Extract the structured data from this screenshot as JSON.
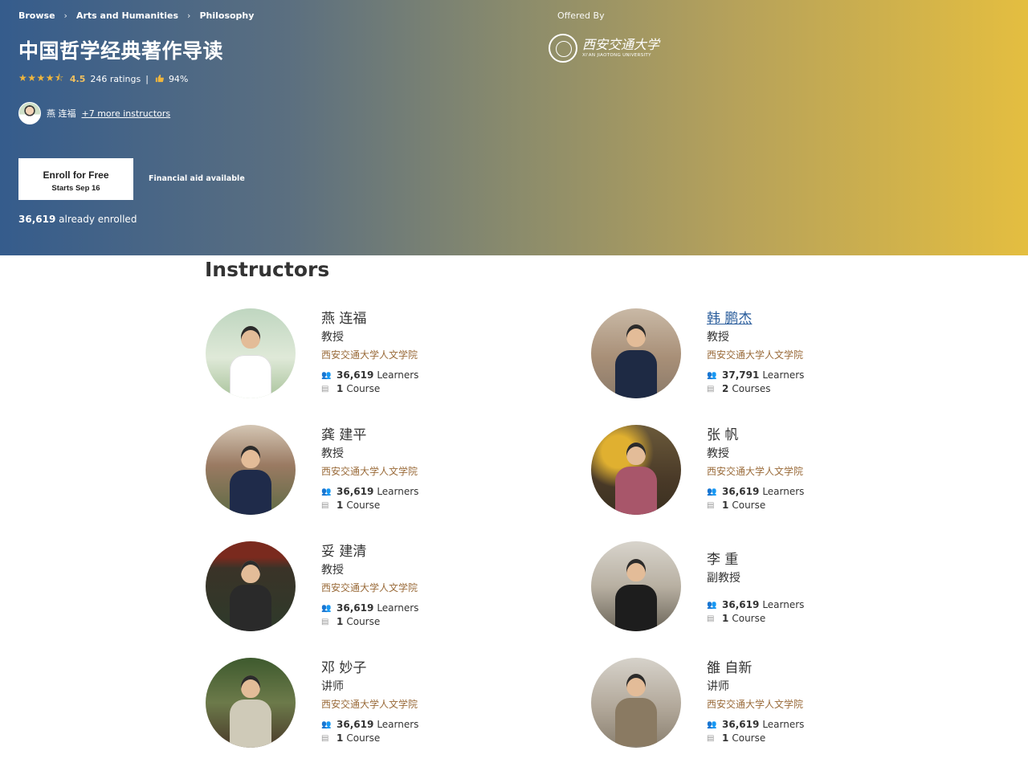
{
  "breadcrumb": {
    "items": [
      "Browse",
      "Arts and Humanities",
      "Philosophy"
    ]
  },
  "course": {
    "title": "中国哲学经典著作导读",
    "rating": "4.5",
    "ratings_count": "246 ratings",
    "separator": "|",
    "like_percent": "94%",
    "stars_glyphs": "★★★★⯪"
  },
  "instructor_line": {
    "name": "燕 连福",
    "more": "+7 more instructors"
  },
  "enroll": {
    "label": "Enroll for Free",
    "sub": "Starts Sep 16",
    "financial_aid": "Financial aid available",
    "enrolled_count": "36,619",
    "enrolled_text": "already enrolled"
  },
  "offered_by": {
    "label": "Offered By",
    "university_cn": "西安交通大学",
    "university_en": "XI'AN JIAOTONG UNIVERSITY"
  },
  "instructors": {
    "title": "Instructors",
    "cards": [
      {
        "name": "燕 连福",
        "role": "教授",
        "org": "西安交通大学人文学院",
        "learners": "36,619",
        "learners_label": "Learners",
        "courses": "1",
        "courses_label": "Course"
      },
      {
        "name": "韩 鹏杰",
        "role": "教授",
        "org": "西安交通大学人文学院",
        "learners": "37,791",
        "learners_label": "Learners",
        "courses": "2",
        "courses_label": "Courses"
      },
      {
        "name": "龚 建平",
        "role": "教授",
        "org": "西安交通大学人文学院",
        "learners": "36,619",
        "learners_label": "Learners",
        "courses": "1",
        "courses_label": "Course"
      },
      {
        "name": "张 帆",
        "role": "教授",
        "org": "西安交通大学人文学院",
        "learners": "36,619",
        "learners_label": "Learners",
        "courses": "1",
        "courses_label": "Course"
      },
      {
        "name": "妥 建清",
        "role": "教授",
        "org": "西安交通大学人文学院",
        "learners": "36,619",
        "learners_label": "Learners",
        "courses": "1",
        "courses_label": "Course"
      },
      {
        "name": "李 重",
        "role": "副教授",
        "org": "",
        "learners": "36,619",
        "learners_label": "Learners",
        "courses": "1",
        "courses_label": "Course"
      },
      {
        "name": "邓 妙子",
        "role": "讲师",
        "org": "西安交通大学人文学院",
        "learners": "36,619",
        "learners_label": "Learners",
        "courses": "1",
        "courses_label": "Course"
      },
      {
        "name": "雒 自新",
        "role": "讲师",
        "org": "西安交通大学人文学院",
        "learners": "36,619",
        "learners_label": "Learners",
        "courses": "1",
        "courses_label": "Course"
      }
    ]
  },
  "icons": {
    "learners": "users-icon",
    "courses": "book-icon",
    "breadcrumb_separator": "chevron-right-icon",
    "like": "thumbs-up-icon"
  },
  "colors": {
    "hero_start": "#355c8c",
    "hero_end": "#e4be40",
    "org_text": "#9a6b3a",
    "link": "#2a5d9c",
    "star": "#f0b63d"
  }
}
